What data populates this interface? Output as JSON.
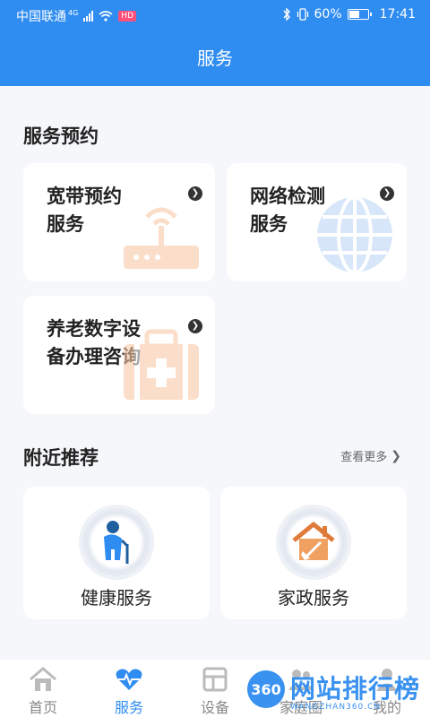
{
  "status_bar": {
    "carrier": "中国联通",
    "network": "4G",
    "badge": "HD",
    "battery_percent": "60%",
    "battery_level": 0.6,
    "time": "17:41",
    "icons": [
      "signal-icon",
      "wifi-icon",
      "bluetooth-icon",
      "vibrate-icon",
      "battery-icon"
    ]
  },
  "header": {
    "title": "服务"
  },
  "booking_section": {
    "title": "服务预约",
    "cards": [
      {
        "line1": "宽带预约",
        "line2": "服务",
        "icon": "router-icon"
      },
      {
        "line1": "网络检测",
        "line2": "服务",
        "icon": "globe-icon"
      },
      {
        "line1": "养老数字设",
        "line2": "备办理咨询",
        "icon": "medical-kit-icon"
      }
    ]
  },
  "nearby_section": {
    "title": "附近推荐",
    "more_label": "查看更多",
    "items": [
      {
        "label": "健康服务",
        "icon": "elderly-person-icon"
      },
      {
        "label": "家政服务",
        "icon": "house-cleaning-icon"
      }
    ]
  },
  "tab_bar": {
    "tabs": [
      {
        "label": "首页",
        "icon": "home-icon"
      },
      {
        "label": "服务",
        "icon": "heartbeat-icon",
        "active": true
      },
      {
        "label": "设备",
        "icon": "device-icon"
      },
      {
        "label": "家庭圈",
        "icon": "family-icon"
      },
      {
        "label": "我的",
        "icon": "profile-icon"
      }
    ]
  },
  "watermark": {
    "logo": "360",
    "text": "网站排行榜",
    "sub": "WANGZHAN360.CN"
  },
  "colors": {
    "primary": "#2f8cf0",
    "icon_orange": "#f7c9a7",
    "icon_blue": "#bcd6f5",
    "text_dark": "#222222"
  }
}
